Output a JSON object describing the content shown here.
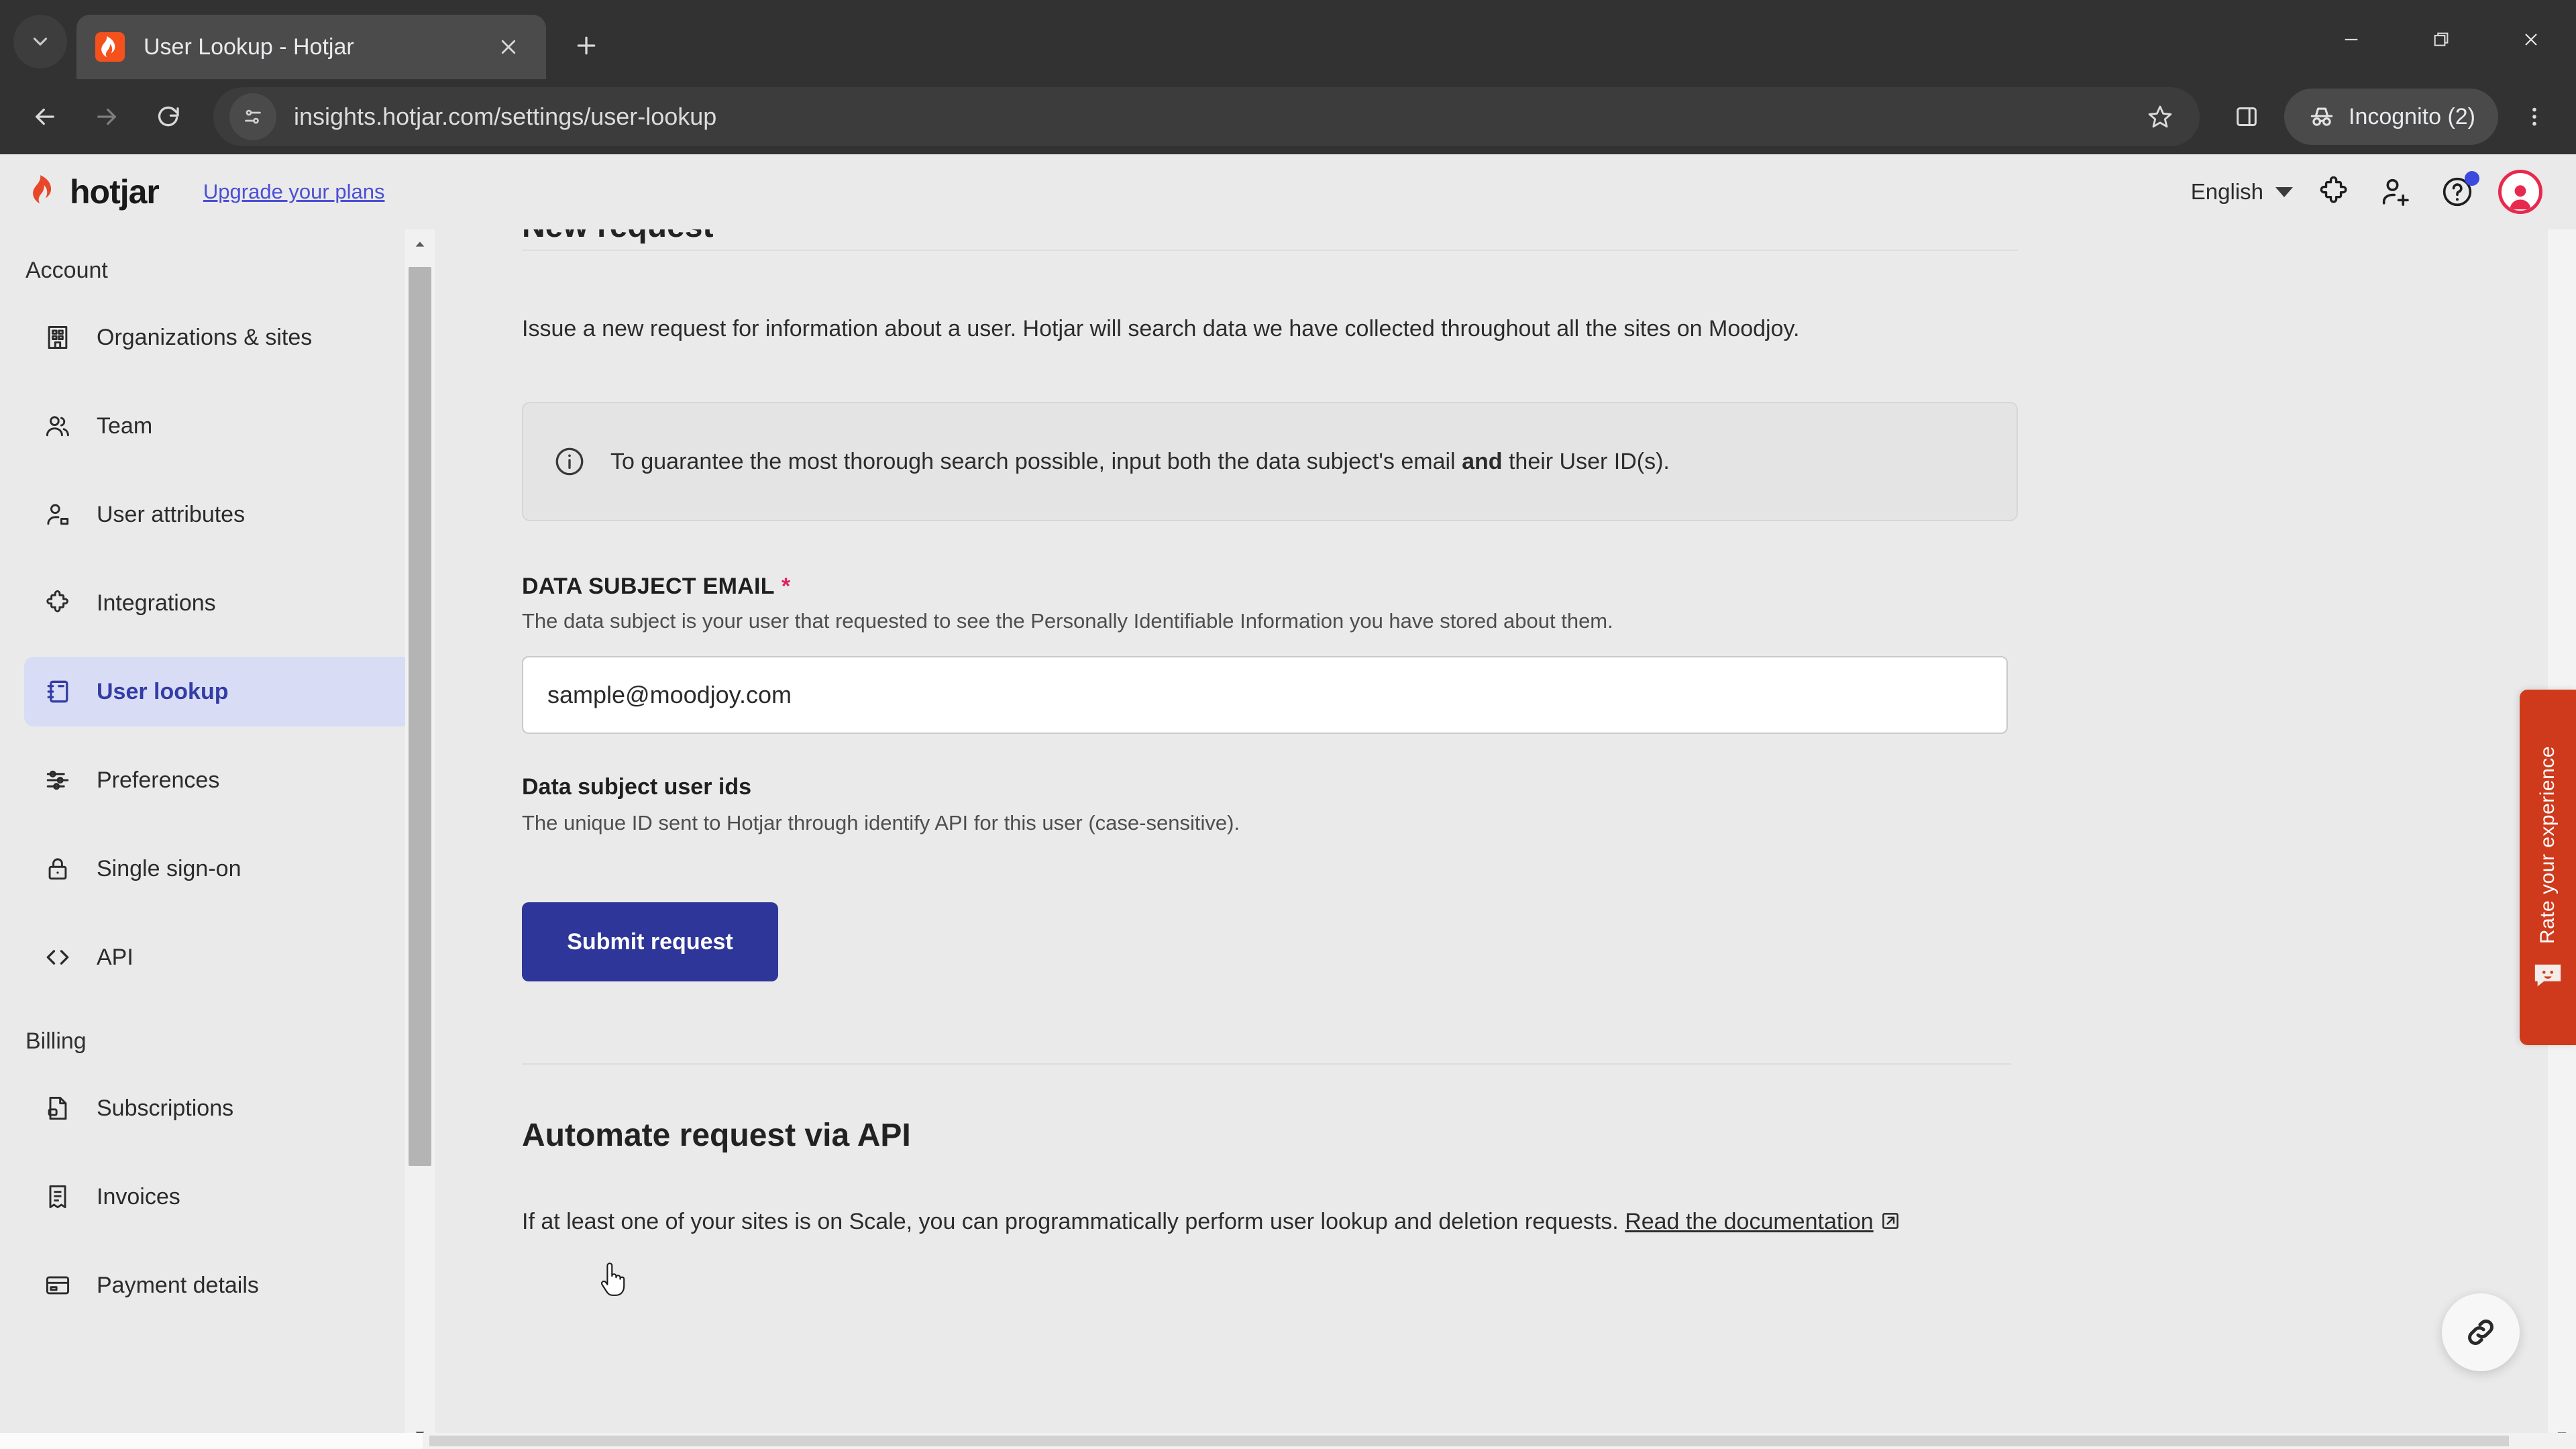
{
  "browser": {
    "tab": {
      "title": "User Lookup - Hotjar",
      "favicon": "hotjar-favicon"
    },
    "new_tab_label": "+",
    "url": "insights.hotjar.com/settings/user-lookup",
    "profile_label": "Incognito (2)",
    "icons": {
      "tab_search": "tab-search-icon",
      "back": "back-arrow-icon",
      "forward": "forward-arrow-icon",
      "reload": "reload-icon",
      "site_info": "page-settings-icon",
      "bookmark": "star-icon",
      "side_panel": "side-panel-icon",
      "incognito": "incognito-hat-icon",
      "menu": "three-dot-menu-icon",
      "minimize": "minimize-icon",
      "maximize": "maximize-icon",
      "close": "close-icon"
    }
  },
  "app_header": {
    "brand": "hotjar",
    "upgrade_link": "Upgrade your plans",
    "language": "English",
    "icons": {
      "puzzle": "puzzle-piece-icon",
      "invite": "invite-user-icon",
      "help": "help-question-icon",
      "avatar": "user-avatar-icon"
    }
  },
  "sidebar": {
    "groups": [
      {
        "title": "Account",
        "items": [
          {
            "label": "Organizations & sites",
            "icon": "building-icon",
            "active": false
          },
          {
            "label": "Team",
            "icon": "people-icon",
            "active": false
          },
          {
            "label": "User attributes",
            "icon": "user-tag-icon",
            "active": false
          },
          {
            "label": "Integrations",
            "icon": "puzzle-piece-icon",
            "active": false
          },
          {
            "label": "User lookup",
            "icon": "notebook-icon",
            "active": true
          },
          {
            "label": "Preferences",
            "icon": "sliders-icon",
            "active": false
          },
          {
            "label": "Single sign-on",
            "icon": "lock-icon",
            "active": false
          },
          {
            "label": "API",
            "icon": "code-brackets-icon",
            "active": false
          }
        ]
      },
      {
        "title": "Billing",
        "items": [
          {
            "label": "Subscriptions",
            "icon": "document-card-icon",
            "active": false
          },
          {
            "label": "Invoices",
            "icon": "receipt-icon",
            "active": false
          },
          {
            "label": "Payment details",
            "icon": "credit-card-icon",
            "active": false
          }
        ]
      }
    ]
  },
  "main": {
    "section_title": "New request",
    "lead": "Issue a new request for information about a user. Hotjar will search data we have collected throughout all the sites on Moodjoy.",
    "info_banner": {
      "icon": "info-circle-icon",
      "text_before": "To guarantee the most thorough search possible, input both the data subject's email ",
      "text_bold": "and",
      "text_after": " their User ID(s)."
    },
    "email_field": {
      "label": "DATA SUBJECT EMAIL",
      "required_mark": "*",
      "help": "The data subject is your user that requested to see the Personally Identifiable Information you have stored about them.",
      "value": "sample@moodjoy.com",
      "placeholder": "sample@moodjoy.com"
    },
    "user_ids_field": {
      "label": "Data subject user ids",
      "help": "The unique ID sent to Hotjar through identify API for this user (case-sensitive)."
    },
    "submit_label": "Submit request",
    "api_section": {
      "title": "Automate request via API",
      "text_before": "If at least one of your sites is on Scale, you can programmatically perform user lookup and deletion requests. ",
      "link_text": "Read the documentation",
      "link_icon": "external-link-icon"
    }
  },
  "widgets": {
    "rate_tab": {
      "label": "Rate your experience",
      "icon": "smiley-feedback-icon",
      "color": "#cf3a1c"
    },
    "float_button": {
      "icon": "link-chain-icon"
    }
  },
  "colors": {
    "accent": "#2f3699",
    "brand_red": "#f5511d",
    "active_nav_bg": "#d8ddf5",
    "active_nav_fg": "#343ca6",
    "page_bg": "#eaeaea",
    "required": "#e0245e"
  }
}
